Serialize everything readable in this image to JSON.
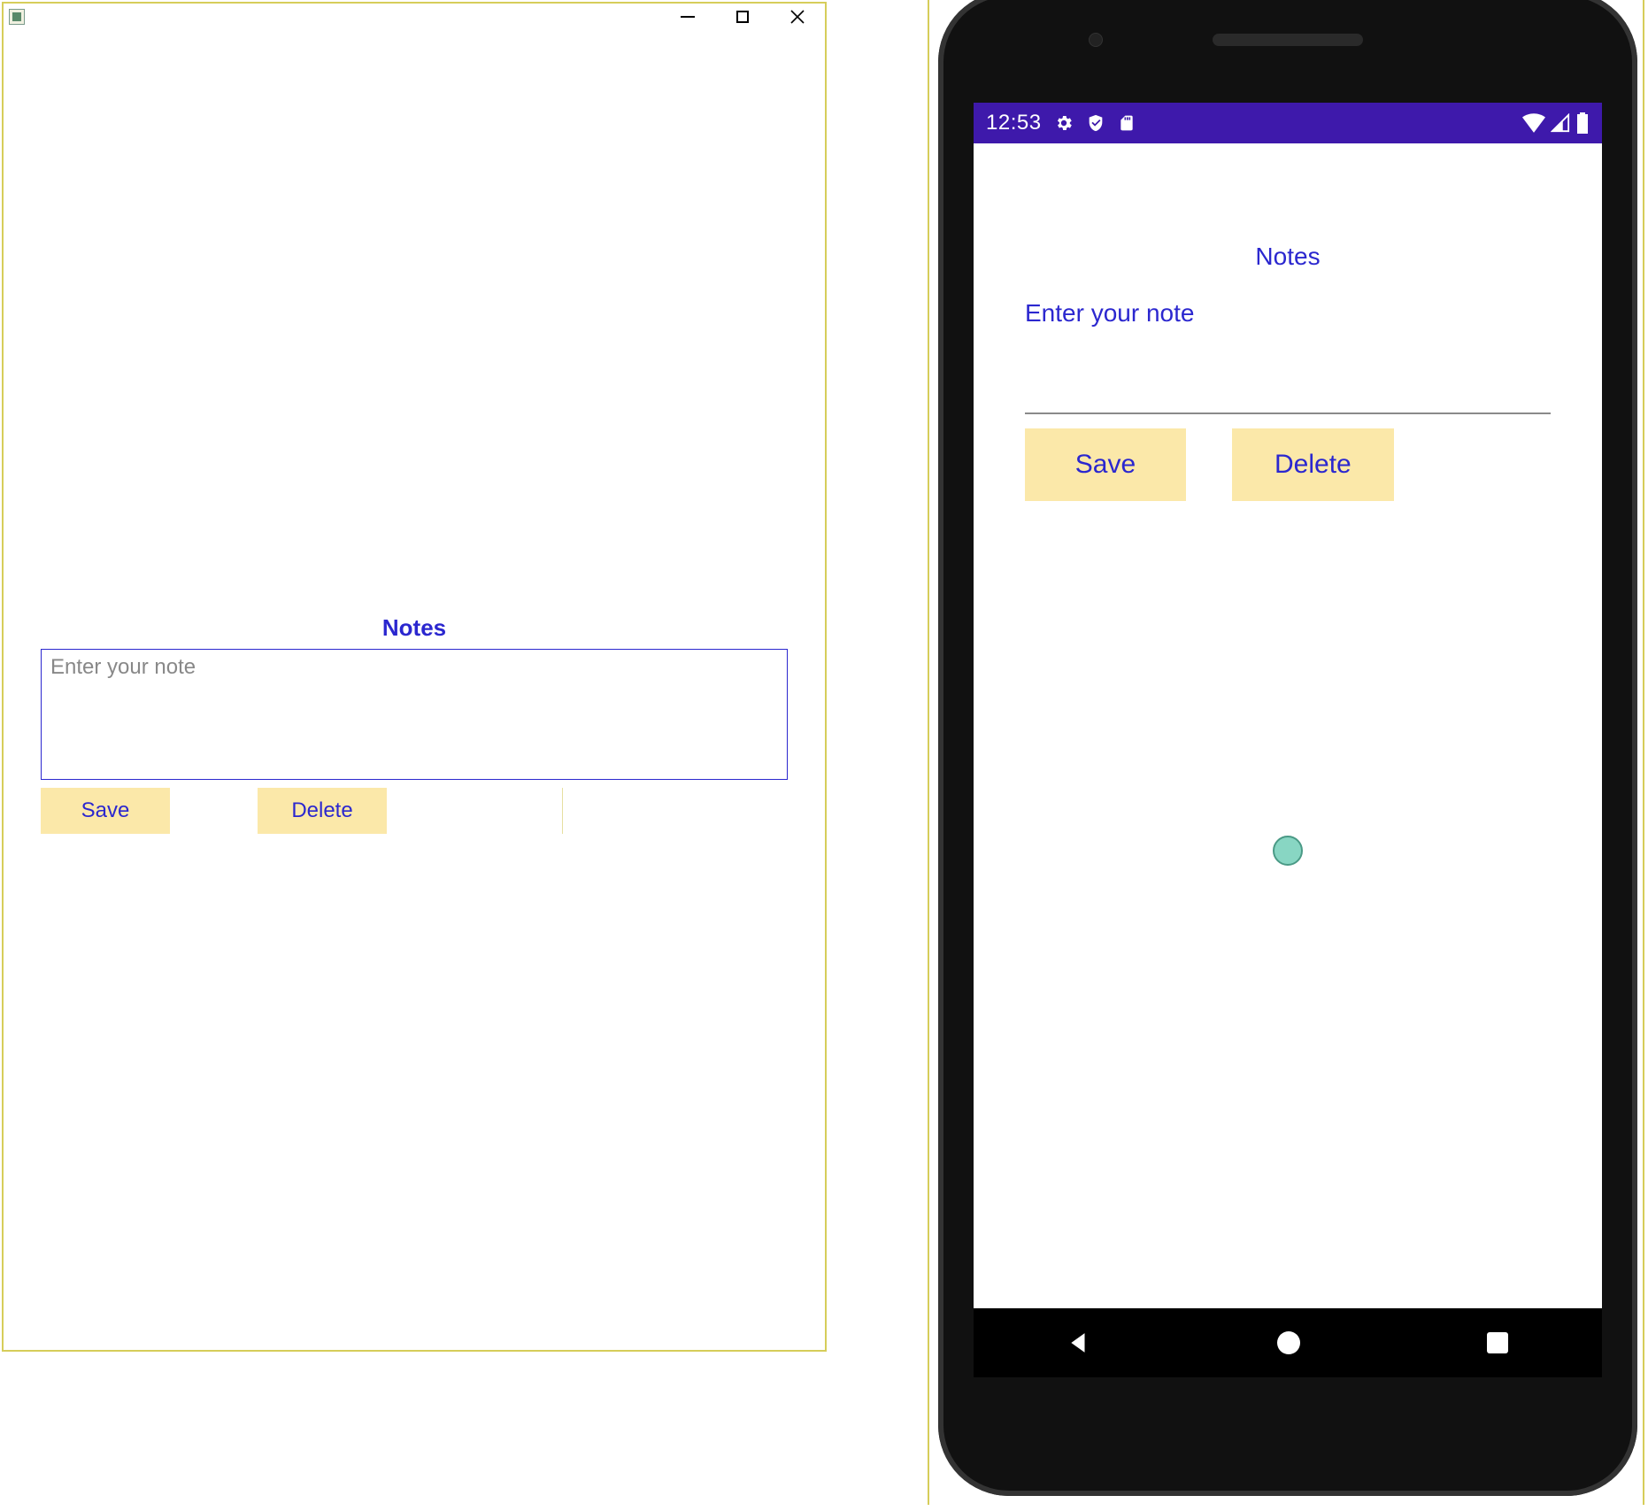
{
  "colors": {
    "accent": "#2b27cf",
    "button_bg": "#fbe8a9",
    "window_border": "#d6cd5a",
    "statusbar_bg": "#3e19ab"
  },
  "desktop": {
    "title": "Notes",
    "editor_placeholder": "Enter your note",
    "editor_value": "",
    "save_label": "Save",
    "delete_label": "Delete"
  },
  "phone": {
    "status_time": "12:53",
    "title": "Notes",
    "editor_placeholder": "Enter your note",
    "save_label": "Save",
    "delete_label": "Delete"
  }
}
